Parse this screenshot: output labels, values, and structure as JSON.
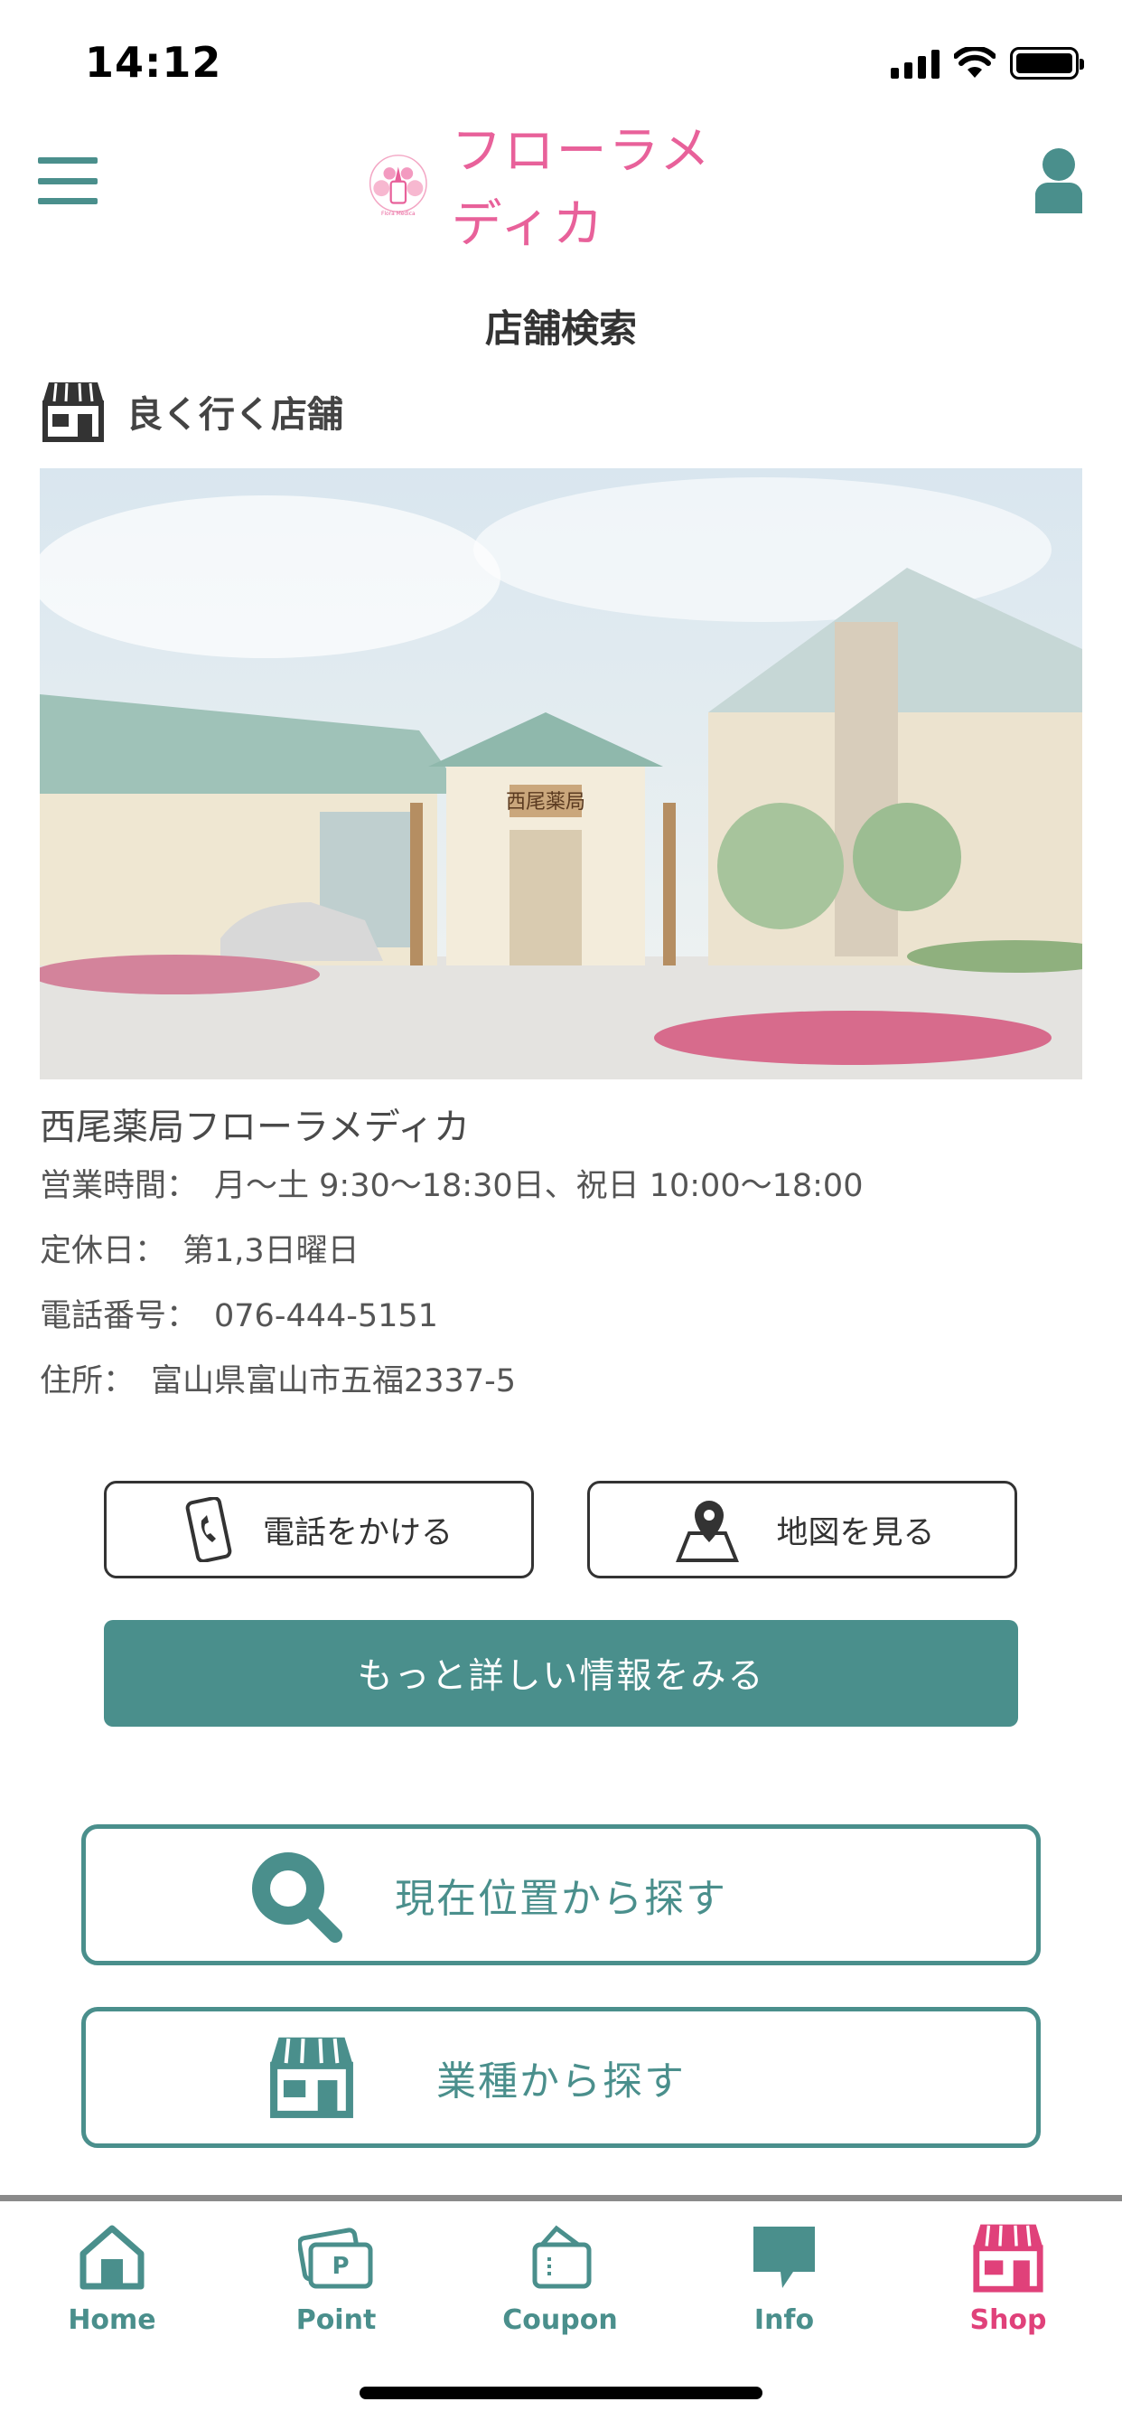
{
  "status_bar": {
    "time": "14:12",
    "battery_level": 1.0,
    "signal_bars": 4
  },
  "header": {
    "logo_text": "フローラメディカ",
    "logo_emblem_text": "Flora Medica",
    "accent_color": "#4a8f8c",
    "brand_color": "#e8619a"
  },
  "page_title": "店舗検索",
  "favorite_section": {
    "title": "良く行く店舗"
  },
  "shop": {
    "name": "西尾薬局フローラメディカ",
    "hours_label": "営業時間：",
    "hours_value": "月〜土 9:30〜18:30日、祝日 10:00〜18:00",
    "closed_label": "定休日：",
    "closed_value": "第1,3日曜日",
    "phone_label": "電話番号：",
    "phone_value": "076-444-5151",
    "address_label": "住所：",
    "address_value": "富山県富山市五福2337-5",
    "sign_text": "西尾薬局"
  },
  "buttons": {
    "call": "電話をかける",
    "map": "地図を見る",
    "more_info": "もっと詳しい情報をみる",
    "search_location": "現在位置から探す",
    "search_category": "業種から探す"
  },
  "tab_bar": {
    "active_color": "#e0417a",
    "tabs": [
      {
        "label": "Home",
        "icon": "home-icon"
      },
      {
        "label": "Point",
        "icon": "point-card-icon",
        "badge": "P"
      },
      {
        "label": "Coupon",
        "icon": "coupon-icon"
      },
      {
        "label": "Info",
        "icon": "chat-bubble-icon"
      },
      {
        "label": "Shop",
        "icon": "shop-icon",
        "active": true
      }
    ]
  }
}
